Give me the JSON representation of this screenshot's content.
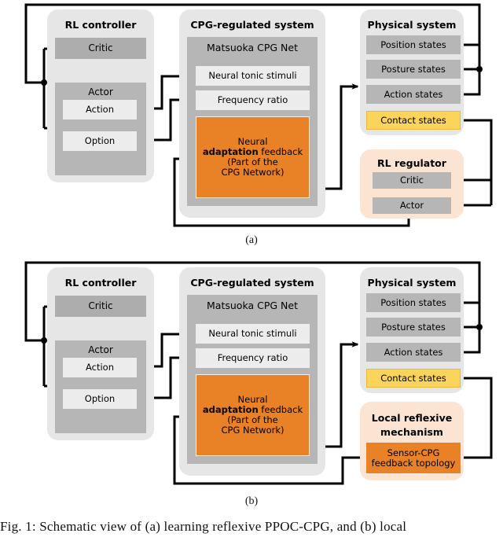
{
  "figure": {
    "caption": "Fig. 1: Schematic view of (a) learning reflexive PPOC-CPG, and (b) local",
    "sub_a": "(a)",
    "sub_b": "(b)"
  },
  "colors": {
    "orange": "#e98127",
    "yellow": "#fbd45c",
    "dark_gray": "#adadad",
    "mid_gray": "#b6b6b6",
    "light_gray": "#ececec",
    "group_gray": "#e6e6e6",
    "peach": "#fce4d2",
    "line": "#000000"
  },
  "panel_a": {
    "rl_controller": {
      "title": "RL controller",
      "critic": "Critic",
      "actor": "Actor",
      "action": "Action",
      "option": "Option"
    },
    "cpg_system": {
      "title": "CPG-regulated system",
      "net_title": "Matsuoka CPG Net",
      "tonic": "Neural tonic stimuli",
      "freq": "Frequency ratio",
      "adaptation": {
        "line1": "Neural",
        "line2_bold": "adaptation",
        "line2_rest": " feedback",
        "line3": "(Part of the",
        "line4": "CPG Network)"
      }
    },
    "physical_system": {
      "title": "Physical system",
      "states": [
        "Position states",
        "Posture states",
        "Action states"
      ],
      "contact": "Contact states"
    },
    "rl_regulator": {
      "title": "RL regulator",
      "critic": "Critic",
      "actor": "Actor"
    }
  },
  "panel_b": {
    "rl_controller": {
      "title": "RL controller",
      "critic": "Critic",
      "actor": "Actor",
      "action": "Action",
      "option": "Option"
    },
    "cpg_system": {
      "title": "CPG-regulated system",
      "net_title": "Matsuoka CPG Net",
      "tonic": "Neural tonic stimuli",
      "freq": "Frequency ratio",
      "adaptation": {
        "line1": "Neural",
        "line2_bold": "adaptation",
        "line2_rest": " feedback",
        "line3": "(Part of the",
        "line4": "CPG Network)"
      }
    },
    "physical_system": {
      "title": "Physical system",
      "states": [
        "Position states",
        "Posture states",
        "Action states"
      ],
      "contact": "Contact states"
    },
    "reflexive": {
      "title_line1": "Local reflexive",
      "title_line2": "mechanism",
      "topology_line1": "Sensor-CPG",
      "topology_line2": "feedback topology"
    }
  }
}
